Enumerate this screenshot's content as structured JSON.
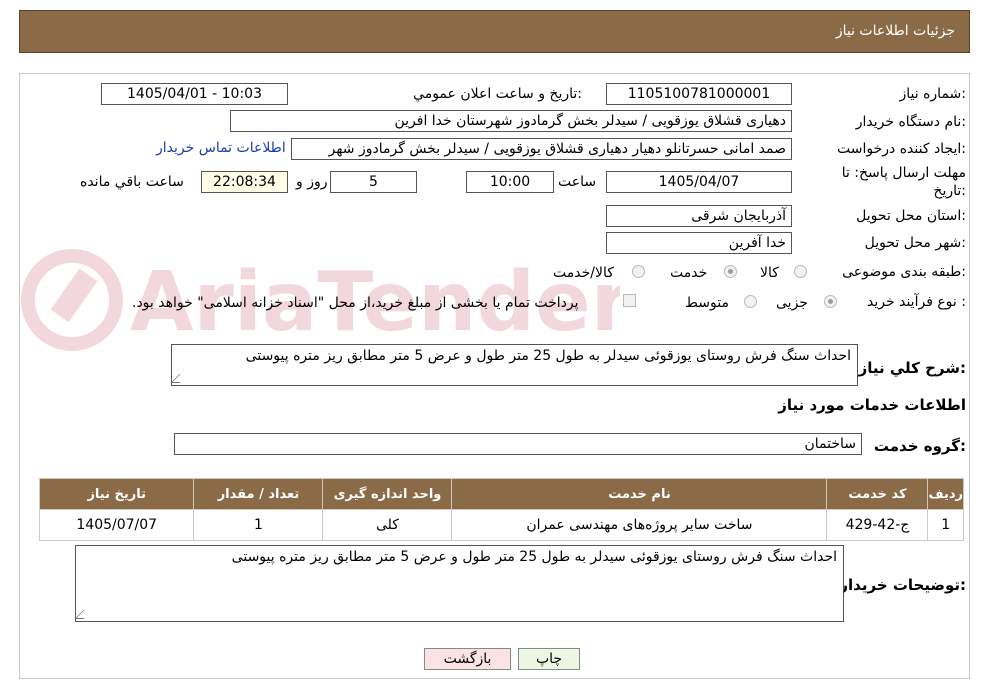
{
  "header": {
    "title": "جزئیات اطلاعات نیاز"
  },
  "form": {
    "need_number_label": "شماره نیاز:",
    "need_number": "1105100781000001",
    "announce_label": "تاریخ و ساعت اعلان عمومي:",
    "announce_value": "1405/04/01 - 10:03",
    "buyer_org_label": "نام دستگاه خریدار:",
    "buyer_org": "دهیاری قشلاق یوزقویی / سیدلر بخش گرمادوز شهرستان خدا افرین",
    "requester_label": "ایجاد کننده درخواست:",
    "requester": "صمد امانی حسرتانلو دهیار دهیاری قشلاق یوزقویی / سیدلر بخش گرمادوز شهر",
    "contact_link": "اطلاعات تماس خریدار",
    "deadline_label_line1": "مهلت ارسال پاسخ: تا",
    "deadline_label_line2": "تاریخ:",
    "deadline_date": "1405/04/07",
    "time_label": "ساعت",
    "deadline_time": "10:00",
    "days_value": "5",
    "days_label": "روز و",
    "remaining_time": "22:08:34",
    "remaining_label": "ساعت باقي مانده",
    "province_label": "استان محل تحویل:",
    "province": "آذربایجان شرقی",
    "city_label": "شهر محل تحویل:",
    "city": "خدا آفرین",
    "category_label": "طبقه بندی موضوعی:",
    "category_options": [
      "کالا",
      "خدمت",
      "کالا/خدمت"
    ],
    "category_selected": "خدمت",
    "process_label": "نوع فرآیند خرید :",
    "process_options": [
      "جزیی",
      "متوسط"
    ],
    "process_selected": "جزیی",
    "payment_note": "پرداخت تمام یا بخشی از مبلغ خرید،از محل \"اسناد خزانه اسلامی\" خواهد بود.",
    "summary_label": "شرح کلي نیاز:",
    "summary": "احداث سنگ فرش روستای یوزقوئی سیدلر به طول 25 متر طول و عرض 5 متر مطابق ریز متره پیوستی",
    "services_heading": "اطلاعات خدمات مورد نیاز",
    "service_group_label": "گروه خدمت:",
    "service_group": "ساختمان",
    "buyer_notes_label": "توضیحات خریدار:",
    "buyer_notes": "احداث سنگ فرش روستای یوزقوئی سیدلر به طول 25 متر طول و عرض 5 متر مطابق ریز متره پیوستی"
  },
  "table": {
    "headers": [
      "ردیف",
      "کد خدمت",
      "نام خدمت",
      "واحد اندازه گیری",
      "تعداد / مقدار",
      "تاریخ نیاز"
    ],
    "rows": [
      [
        "1",
        "ج-42-429",
        "ساخت سایر پروژه‌های مهندسی عمران",
        "کلی",
        "1",
        "1405/07/07"
      ]
    ]
  },
  "buttons": {
    "print": "چاپ",
    "back": "بازگشت"
  },
  "watermark": {
    "text": "AriaTender.neT"
  },
  "colors": {
    "header_bg": "#8b6b47",
    "link": "#1a3ea8",
    "print_btn": "#e9f7e3",
    "back_btn": "#fbe3e3"
  }
}
